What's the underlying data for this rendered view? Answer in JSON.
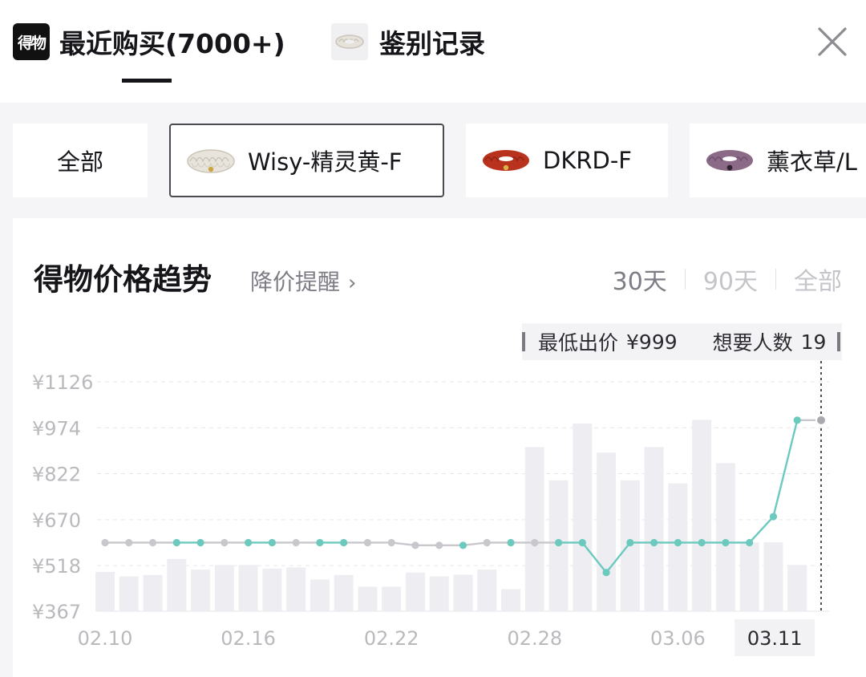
{
  "header": {
    "logo_text": "得物",
    "tabs": [
      {
        "label": "最近购买(7000+)",
        "active": true
      },
      {
        "label": "鉴别记录",
        "active": false
      }
    ],
    "close_icon": "close-icon"
  },
  "filters": [
    {
      "label": "全部",
      "selected": false
    },
    {
      "label": "Wisy-精灵黄-F",
      "selected": true,
      "thumb_color": "#e8e4dc"
    },
    {
      "label": "DKRD-F",
      "selected": false,
      "thumb_color": "#b8321e"
    },
    {
      "label": "薰衣草/L",
      "selected": false,
      "thumb_color": "#8a6a86"
    }
  ],
  "card": {
    "title": "得物价格趋势",
    "alert_link": "降价提醒",
    "ranges": [
      "30天",
      "90天",
      "全部"
    ],
    "active_range": "30天"
  },
  "tooltip": {
    "min_label": "最低出价",
    "min_value": "¥999",
    "want_label": "想要人数",
    "want_value": "19"
  },
  "colors": {
    "accent": "#6cc9be",
    "line_gray": "#c8c8cc",
    "bar": "#eeeef2"
  },
  "chart_data": {
    "type": "line",
    "title": "得物价格趋势",
    "y_tick_labels": [
      "¥1126",
      "¥974",
      "¥822",
      "¥670",
      "¥518",
      "¥367"
    ],
    "y_ticks": [
      1126,
      974,
      822,
      670,
      518,
      367
    ],
    "ylim": [
      367,
      1126
    ],
    "x_tick_labels": [
      "02.10",
      "02.16",
      "02.22",
      "02.28",
      "03.06",
      "03.11"
    ],
    "x_tick_index": [
      0,
      6,
      12,
      18,
      24,
      29
    ],
    "highlight_tick": "03.11",
    "grid": "horizontal-dashed",
    "series": [
      {
        "kind": "line",
        "values": [
          594,
          594,
          594,
          594,
          594,
          594,
          594,
          594,
          594,
          594,
          594,
          594,
          594,
          585,
          585,
          585,
          594,
          594,
          594,
          594,
          594,
          495,
          594,
          594,
          594,
          594,
          594,
          594,
          680,
          999,
          999
        ],
        "highlighted": [
          false,
          false,
          false,
          true,
          true,
          false,
          true,
          true,
          false,
          true,
          true,
          false,
          false,
          false,
          false,
          true,
          false,
          true,
          false,
          true,
          true,
          true,
          true,
          true,
          true,
          true,
          true,
          true,
          true,
          true,
          false
        ]
      },
      {
        "kind": "bar",
        "values": [
          497,
          482,
          487,
          540,
          505,
          520,
          520,
          508,
          512,
          472,
          487,
          448,
          448,
          495,
          482,
          488,
          505,
          440,
          910,
          800,
          988,
          892,
          800,
          910,
          790,
          1000,
          857,
          595,
          595,
          520
        ]
      }
    ]
  }
}
